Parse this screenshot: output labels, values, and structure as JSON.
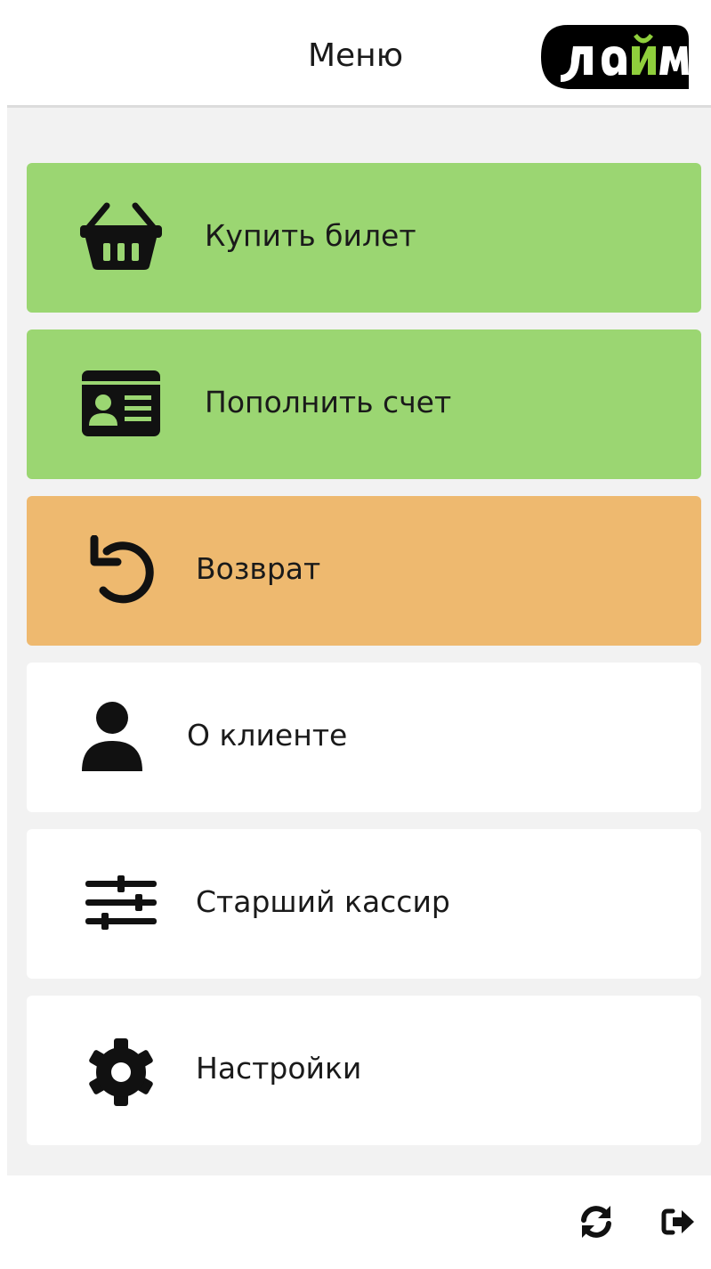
{
  "header": {
    "title": "Меню",
    "logo_text": "лайм",
    "logo_accent_color": "#8fcf3c"
  },
  "menu": {
    "items": [
      {
        "label": "Купить билет",
        "icon": "basket-icon",
        "color": "#9bd672"
      },
      {
        "label": "Пополнить счет",
        "icon": "id-card-icon",
        "color": "#9bd672"
      },
      {
        "label": "Возврат",
        "icon": "undo-icon",
        "color": "#eeb96f"
      },
      {
        "label": "О клиенте",
        "icon": "user-icon",
        "color": "#ffffff"
      },
      {
        "label": "Старший кассир",
        "icon": "sliders-icon",
        "color": "#ffffff"
      },
      {
        "label": "Настройки",
        "icon": "gear-icon",
        "color": "#ffffff"
      }
    ]
  },
  "footer": {
    "buttons": [
      {
        "icon": "refresh-icon"
      },
      {
        "icon": "logout-icon"
      }
    ]
  }
}
